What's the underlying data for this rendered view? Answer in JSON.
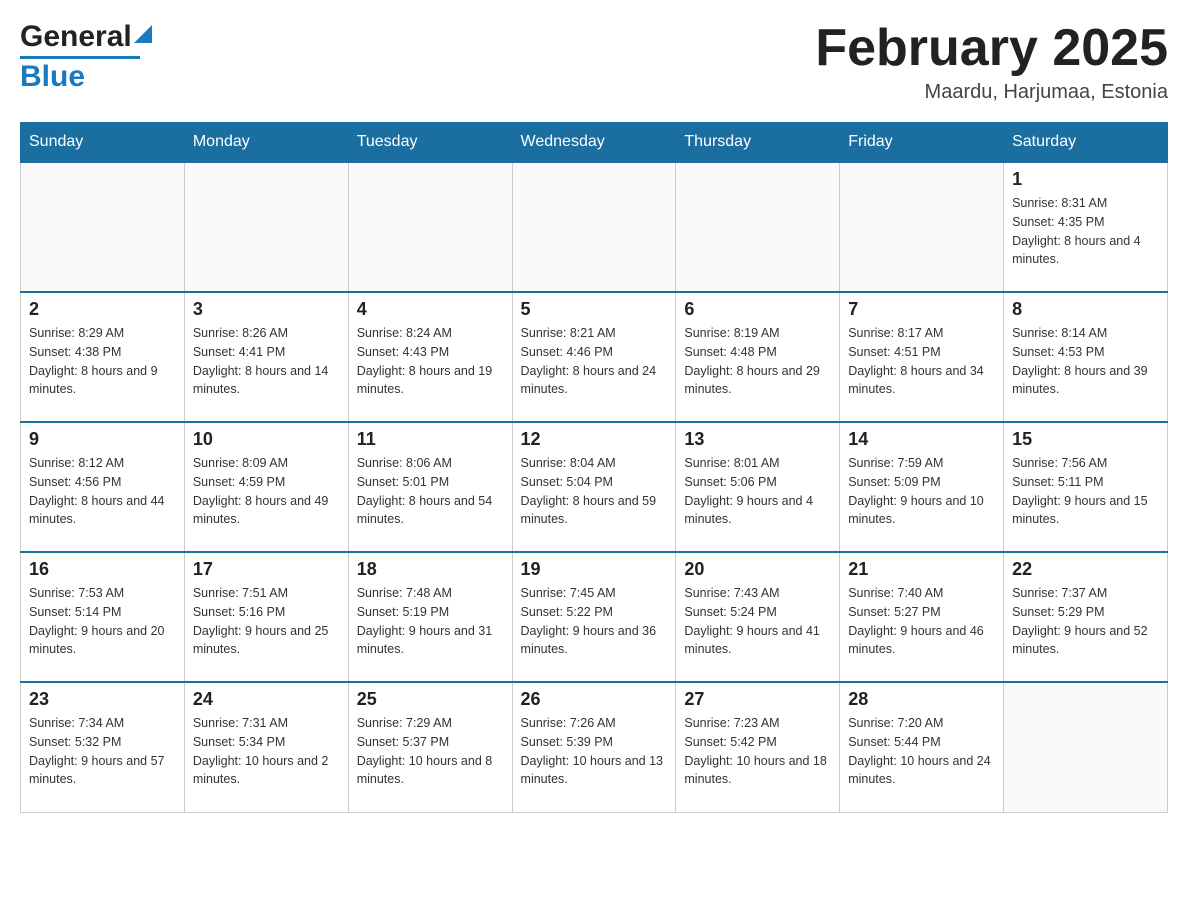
{
  "header": {
    "logo_general": "General",
    "logo_blue": "Blue",
    "month_title": "February 2025",
    "location": "Maardu, Harjumaa, Estonia"
  },
  "days_of_week": [
    "Sunday",
    "Monday",
    "Tuesday",
    "Wednesday",
    "Thursday",
    "Friday",
    "Saturday"
  ],
  "weeks": [
    {
      "cells": [
        {
          "empty": true
        },
        {
          "empty": true
        },
        {
          "empty": true
        },
        {
          "empty": true
        },
        {
          "empty": true
        },
        {
          "empty": true
        },
        {
          "day": 1,
          "sunrise": "8:31 AM",
          "sunset": "4:35 PM",
          "daylight": "8 hours and 4 minutes."
        }
      ]
    },
    {
      "cells": [
        {
          "day": 2,
          "sunrise": "8:29 AM",
          "sunset": "4:38 PM",
          "daylight": "8 hours and 9 minutes."
        },
        {
          "day": 3,
          "sunrise": "8:26 AM",
          "sunset": "4:41 PM",
          "daylight": "8 hours and 14 minutes."
        },
        {
          "day": 4,
          "sunrise": "8:24 AM",
          "sunset": "4:43 PM",
          "daylight": "8 hours and 19 minutes."
        },
        {
          "day": 5,
          "sunrise": "8:21 AM",
          "sunset": "4:46 PM",
          "daylight": "8 hours and 24 minutes."
        },
        {
          "day": 6,
          "sunrise": "8:19 AM",
          "sunset": "4:48 PM",
          "daylight": "8 hours and 29 minutes."
        },
        {
          "day": 7,
          "sunrise": "8:17 AM",
          "sunset": "4:51 PM",
          "daylight": "8 hours and 34 minutes."
        },
        {
          "day": 8,
          "sunrise": "8:14 AM",
          "sunset": "4:53 PM",
          "daylight": "8 hours and 39 minutes."
        }
      ]
    },
    {
      "cells": [
        {
          "day": 9,
          "sunrise": "8:12 AM",
          "sunset": "4:56 PM",
          "daylight": "8 hours and 44 minutes."
        },
        {
          "day": 10,
          "sunrise": "8:09 AM",
          "sunset": "4:59 PM",
          "daylight": "8 hours and 49 minutes."
        },
        {
          "day": 11,
          "sunrise": "8:06 AM",
          "sunset": "5:01 PM",
          "daylight": "8 hours and 54 minutes."
        },
        {
          "day": 12,
          "sunrise": "8:04 AM",
          "sunset": "5:04 PM",
          "daylight": "8 hours and 59 minutes."
        },
        {
          "day": 13,
          "sunrise": "8:01 AM",
          "sunset": "5:06 PM",
          "daylight": "9 hours and 4 minutes."
        },
        {
          "day": 14,
          "sunrise": "7:59 AM",
          "sunset": "5:09 PM",
          "daylight": "9 hours and 10 minutes."
        },
        {
          "day": 15,
          "sunrise": "7:56 AM",
          "sunset": "5:11 PM",
          "daylight": "9 hours and 15 minutes."
        }
      ]
    },
    {
      "cells": [
        {
          "day": 16,
          "sunrise": "7:53 AM",
          "sunset": "5:14 PM",
          "daylight": "9 hours and 20 minutes."
        },
        {
          "day": 17,
          "sunrise": "7:51 AM",
          "sunset": "5:16 PM",
          "daylight": "9 hours and 25 minutes."
        },
        {
          "day": 18,
          "sunrise": "7:48 AM",
          "sunset": "5:19 PM",
          "daylight": "9 hours and 31 minutes."
        },
        {
          "day": 19,
          "sunrise": "7:45 AM",
          "sunset": "5:22 PM",
          "daylight": "9 hours and 36 minutes."
        },
        {
          "day": 20,
          "sunrise": "7:43 AM",
          "sunset": "5:24 PM",
          "daylight": "9 hours and 41 minutes."
        },
        {
          "day": 21,
          "sunrise": "7:40 AM",
          "sunset": "5:27 PM",
          "daylight": "9 hours and 46 minutes."
        },
        {
          "day": 22,
          "sunrise": "7:37 AM",
          "sunset": "5:29 PM",
          "daylight": "9 hours and 52 minutes."
        }
      ]
    },
    {
      "cells": [
        {
          "day": 23,
          "sunrise": "7:34 AM",
          "sunset": "5:32 PM",
          "daylight": "9 hours and 57 minutes."
        },
        {
          "day": 24,
          "sunrise": "7:31 AM",
          "sunset": "5:34 PM",
          "daylight": "10 hours and 2 minutes."
        },
        {
          "day": 25,
          "sunrise": "7:29 AM",
          "sunset": "5:37 PM",
          "daylight": "10 hours and 8 minutes."
        },
        {
          "day": 26,
          "sunrise": "7:26 AM",
          "sunset": "5:39 PM",
          "daylight": "10 hours and 13 minutes."
        },
        {
          "day": 27,
          "sunrise": "7:23 AM",
          "sunset": "5:42 PM",
          "daylight": "10 hours and 18 minutes."
        },
        {
          "day": 28,
          "sunrise": "7:20 AM",
          "sunset": "5:44 PM",
          "daylight": "10 hours and 24 minutes."
        },
        {
          "empty": true
        }
      ]
    }
  ],
  "labels": {
    "sunrise": "Sunrise:",
    "sunset": "Sunset:",
    "daylight": "Daylight:"
  }
}
